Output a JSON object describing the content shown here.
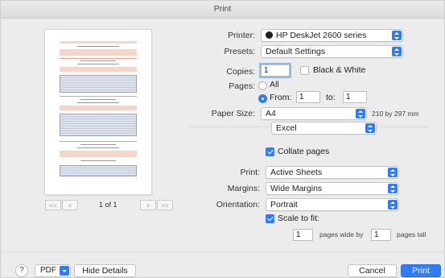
{
  "window": {
    "title": "Print"
  },
  "preview": {
    "page_label": "1 of 1"
  },
  "pager": {
    "first_label": "<<",
    "prev_label": "<",
    "next_label": ">",
    "last_label": ">>"
  },
  "printer": {
    "label": "Printer:",
    "value": "HP DeskJet 2600 series"
  },
  "presets": {
    "label": "Presets:",
    "value": "Default Settings"
  },
  "copies": {
    "label": "Copies:",
    "value": "1",
    "bw_label": "Black & White",
    "bw_checked": false
  },
  "pages": {
    "label": "Pages:",
    "all_label": "All",
    "from_label": "From:",
    "from_value": "1",
    "to_label": "to:",
    "to_value": "1",
    "selected": "from"
  },
  "paper_size": {
    "label": "Paper Size:",
    "value": "A4",
    "dimensions": "210 by 297 mm"
  },
  "section_popup": {
    "value": "Excel"
  },
  "collate": {
    "label": "Collate pages",
    "checked": true
  },
  "print_what": {
    "label": "Print:",
    "value": "Active Sheets"
  },
  "margins": {
    "label": "Margins:",
    "value": "Wide Margins"
  },
  "orientation": {
    "label": "Orientation:",
    "value": "Portrait"
  },
  "scale": {
    "label": "Scale to fit:",
    "checked": true,
    "wide_value": "1",
    "wide_label": "pages wide by",
    "tall_value": "1",
    "tall_label": "pages tall"
  },
  "footer": {
    "help_label": "?",
    "pdf_label": "PDF",
    "hide_details_label": "Hide Details",
    "cancel_label": "Cancel",
    "print_label": "Print"
  },
  "colors": {
    "accent": "#2f7cf6",
    "preview_band": "#f4d7c9"
  }
}
